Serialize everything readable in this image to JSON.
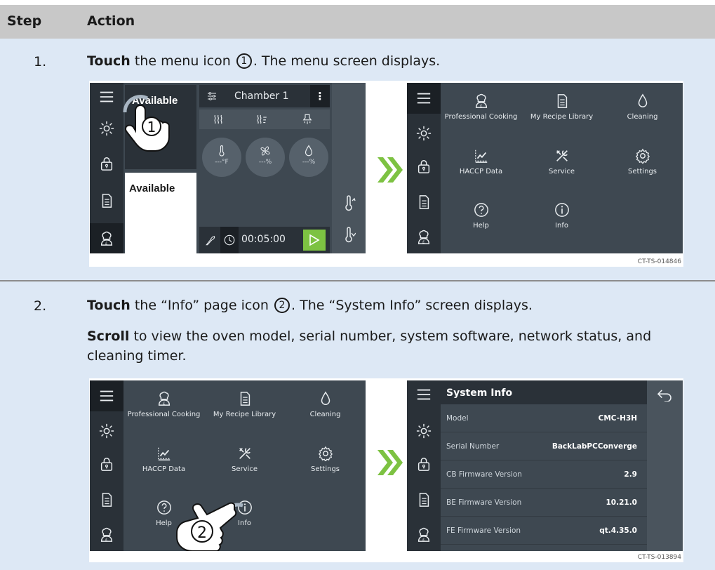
{
  "header": {
    "step_label": "Step",
    "action_label": "Action"
  },
  "step1": {
    "number": "1.",
    "verb": "Touch",
    "text_a": " the menu icon ",
    "callout": "1",
    "text_b": ". The menu screen displays.",
    "figure_code": "CT-TS-014846",
    "home_screen": {
      "status_card_1": "Available",
      "status_card_2": "Available",
      "chamber_label": "Chamber 1",
      "more_glyph": "⋮",
      "gauges": [
        "---°F",
        "---%",
        "---%"
      ],
      "timer": "00:05:00"
    }
  },
  "menu": {
    "items": [
      {
        "label": "Professional Cooking",
        "icon": "chef-icon"
      },
      {
        "label": "My Recipe Library",
        "icon": "recipe-book-icon"
      },
      {
        "label": "Cleaning",
        "icon": "droplet-icon"
      },
      {
        "label": "HACCP Data",
        "icon": "chart-icon"
      },
      {
        "label": "Service",
        "icon": "tools-icon"
      },
      {
        "label": "Settings",
        "icon": "gear-icon"
      },
      {
        "label": "Help",
        "icon": "help-icon"
      },
      {
        "label": "Info",
        "icon": "info-icon"
      }
    ]
  },
  "step2": {
    "number": "2.",
    "verb": "Touch",
    "text_a": " the “Info” page icon ",
    "callout": "2",
    "text_b": ". The “System Info” screen displays.",
    "verb2": "Scroll",
    "text_c": " to view the oven model, serial number, system software, network status, and cleaning timer.",
    "figure_code": "CT-TS-013894"
  },
  "system_info": {
    "title": "System Info",
    "rows": [
      {
        "key": "Model",
        "value": "CMC-H3H"
      },
      {
        "key": "Serial Number",
        "value": "BackLabPCConverge"
      },
      {
        "key": "CB Firmware Version",
        "value": "2.9"
      },
      {
        "key": "BE Firmware Version",
        "value": "10.21.0"
      },
      {
        "key": "FE Firmware Version",
        "value": "qt.4.35.0"
      }
    ]
  },
  "colors": {
    "screen_bg": "#3e4851",
    "sidebar_bg": "#2a3138",
    "accent_green": "#7dc242",
    "row_bg": "#dde8f5",
    "header_bg": "#c8c8c8"
  }
}
